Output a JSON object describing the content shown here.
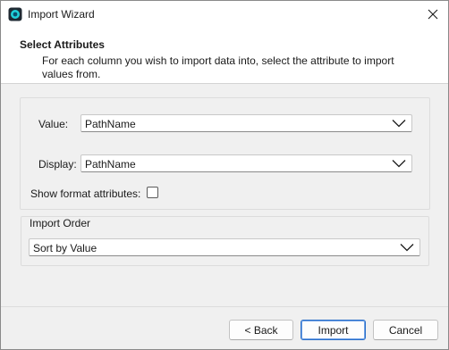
{
  "window": {
    "title": "Import Wizard",
    "app_icon": "app-icon",
    "close_icon": "close-icon"
  },
  "header": {
    "title": "Select Attributes",
    "description": "For each column you wish to import data into, select the attribute to import values from."
  },
  "attributes": {
    "value_label": "Value:",
    "value_selected": "PathName",
    "display_label": "Display:",
    "display_selected": "PathName",
    "show_format_label": "Show format attributes:",
    "show_format_checked": false
  },
  "import_order": {
    "group_title": "Import Order",
    "selected": "Sort by Value"
  },
  "buttons": {
    "back": "< Back",
    "import": "Import",
    "cancel": "Cancel"
  },
  "colors": {
    "accent": "#2a6fc9",
    "window_bg": "#f0f0f0"
  }
}
